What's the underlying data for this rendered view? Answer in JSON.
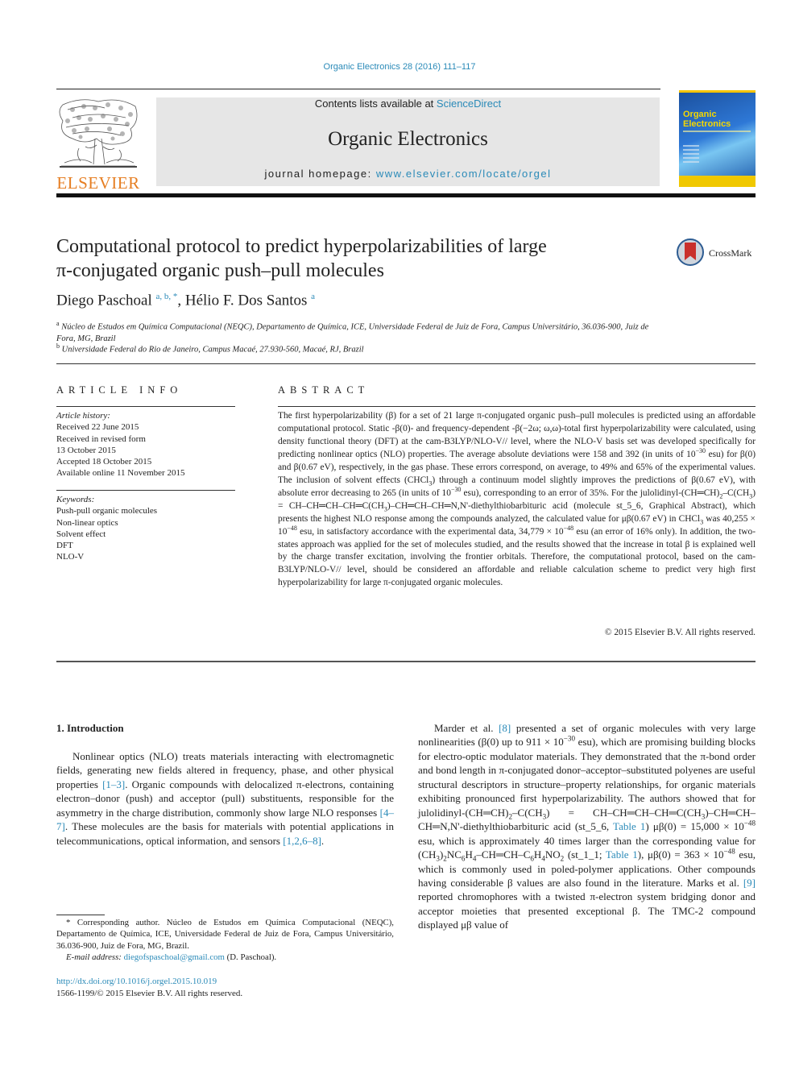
{
  "citation": "Organic Electronics 28 (2016) 111–117",
  "publisher": {
    "logo_word": "ELSEVIER"
  },
  "masthead": {
    "contents_prefix": "Contents lists available at ",
    "contents_link": "ScienceDirect",
    "journal_title": "Organic Electronics",
    "homepage_prefix": "journal homepage: ",
    "homepage_link": "www.elsevier.com/locate/orgel"
  },
  "cover": {
    "title_line1": "Organic",
    "title_line2": "Electronics"
  },
  "article": {
    "title_line1": "Computational protocol to predict hyperpolarizabilities of large",
    "title_line2": "π-conjugated organic push–pull molecules",
    "crossmark_label": "CrossMark",
    "authors": [
      {
        "name": "Diego Paschoal",
        "marks": "a, b, *"
      },
      {
        "name": "Hélio F. Dos Santos",
        "marks": "a"
      }
    ],
    "author_separator": ", ",
    "affiliations": [
      {
        "mark": "a",
        "text": "Núcleo de Estudos em Química Computacional (NEQC), Departamento de Química, ICE, Universidade Federal de Juiz de Fora, Campus Universitário, 36.036-900, Juiz de Fora, MG, Brazil"
      },
      {
        "mark": "b",
        "text": "Universidade Federal do Rio de Janeiro, Campus Macaé, 27.930-560, Macaé, RJ, Brazil"
      }
    ]
  },
  "article_info": {
    "heading": "ARTICLE INFO",
    "history_label": "Article history:",
    "history": [
      "Received 22 June 2015",
      "Received in revised form",
      "13 October 2015",
      "Accepted 18 October 2015",
      "Available online 11 November 2015"
    ],
    "keywords_label": "Keywords:",
    "keywords": [
      "Push-pull organic molecules",
      "Non-linear optics",
      "Solvent effect",
      "DFT",
      "NLO-V"
    ]
  },
  "abstract": {
    "heading": "ABSTRACT",
    "parts": [
      "The first hyperpolarizability (β) for a set of 21 large π-conjugated organic push–pull molecules is predicted using an affordable computational protocol. Static -β(0)- and frequency-dependent -β(−2ω; ω,ω)-total first hyperpolarizability were calculated, using density functional theory (DFT) at the cam-B3LYP/NLO-V// level, where the NLO-V basis set was developed specifically for predicting nonlinear optics (NLO) properties. The average absolute deviations were 158 and 392 (in units of 10",
      "−30",
      " esu) for β(0) and β(0.67 eV), respectively, in the gas phase. These errors correspond, on average, to 49% and 65% of the experimental values. The inclusion of solvent effects (CHCl",
      "3",
      ") through a continuum model slightly improves the predictions of β(0.67 eV), with absolute error decreasing to 265 (in units of 10",
      "−30",
      " esu), corresponding to an error of 35%. For the julolidinyl-(CH═CH)",
      "2",
      "–C(CH",
      "3",
      ") = CH–CH═CH–CH═C(CH",
      "3",
      ")–CH═CH–CH═N,N'-diethylthiobarbituric acid (molecule st_5_6, Graphical Abstract), which presents the highest NLO response among the compounds analyzed, the calculated value for μβ(0.67 eV) in CHCl",
      "3",
      " was 40,255 × 10",
      "−48",
      " esu, in satisfactory accordance with the experimental data, 34,779 × 10",
      "−48",
      " esu (an error of 16% only). In addition, the two-states approach was applied for the set of molecules studied, and the results showed that the increase in total β is explained well by the charge transfer excitation, involving the frontier orbitals. Therefore, the computational protocol, based on the cam-B3LYP/NLO-V// level, should be considered an affordable and reliable calculation scheme to predict very high first hyperpolarizability for large π-conjugated organic molecules."
    ],
    "copyright": "© 2015 Elsevier B.V. All rights reserved."
  },
  "introduction": {
    "heading": "1.  Introduction",
    "p1": [
      "Nonlinear optics (NLO) treats materials interacting with electromagnetic fields, generating new fields altered in frequency, phase, and other physical properties ",
      "[1–3]",
      ". Organic compounds with delocalized π-electrons, containing electron–donor (push) and acceptor (pull) substituents, responsible for the asymmetry in the charge distribution, commonly show large NLO responses ",
      "[4–7]",
      ". These molecules are the basis for materials with potential applications in telecommunications, optical information, and sensors ",
      "[1,2,6–8]",
      "."
    ],
    "p2": [
      "Marder et al. ",
      "[8]",
      " presented a set of organic molecules with very large nonlinearities (β(0) up to 911 × 10",
      "−30",
      " esu), which are promising building blocks for electro-optic modulator materials. They demonstrated that the π-bond order and bond length in π-conjugated donor–acceptor–substituted polyenes are useful structural descriptors in structure–property relationships, for organic materials exhibiting pronounced first hyperpolarizability. The authors showed that for julolidinyl-(CH═CH)",
      "2",
      "–C(CH",
      "3",
      ") = CH–CH═CH–CH═C(CH",
      "3",
      ")–CH═CH–CH═N,N'-diethylthiobarbituric acid (st_5_6, ",
      "Table 1",
      ") μβ(0) = 15,000 × 10",
      "−48",
      " esu, which is approximately 40 times larger than the corresponding value for (CH",
      "3",
      ")",
      "2",
      "NC",
      "6",
      "H",
      "4",
      "–CH═CH–C",
      "6",
      "H",
      "4",
      "NO",
      "2",
      " (st_1_1; ",
      "Table 1",
      "), μβ(0) = 363 × 10",
      "−48",
      " esu, which is commonly used in poled-polymer applications. Other compounds having considerable β values are also found in the literature. Marks et al. ",
      "[9]",
      " reported chromophores with a twisted π-electron system bridging donor and acceptor moieties that presented exceptional β. The TMC-2 compound displayed μβ value of"
    ]
  },
  "footnote": {
    "corresponding": "* Corresponding author. Núcleo de Estudos em Química Computacional (NEQC), Departamento de Química, ICE, Universidade Federal de Juiz de Fora, Campus Universitário, 36.036-900, Juiz de Fora, MG, Brazil.",
    "email_label": "E-mail address: ",
    "email": "diegofspaschoal@gmail.com",
    "email_suffix": " (D. Paschoal)."
  },
  "doi": {
    "link": "http://dx.doi.org/10.1016/j.orgel.2015.10.019",
    "issn_line": "1566-1199/© 2015 Elsevier B.V. All rights reserved."
  },
  "colors": {
    "link": "#2a8ab8",
    "elsevier_orange": "#e67e22",
    "masthead_bg": "#e6e6e6",
    "crossmark_red": "#c9302c"
  }
}
